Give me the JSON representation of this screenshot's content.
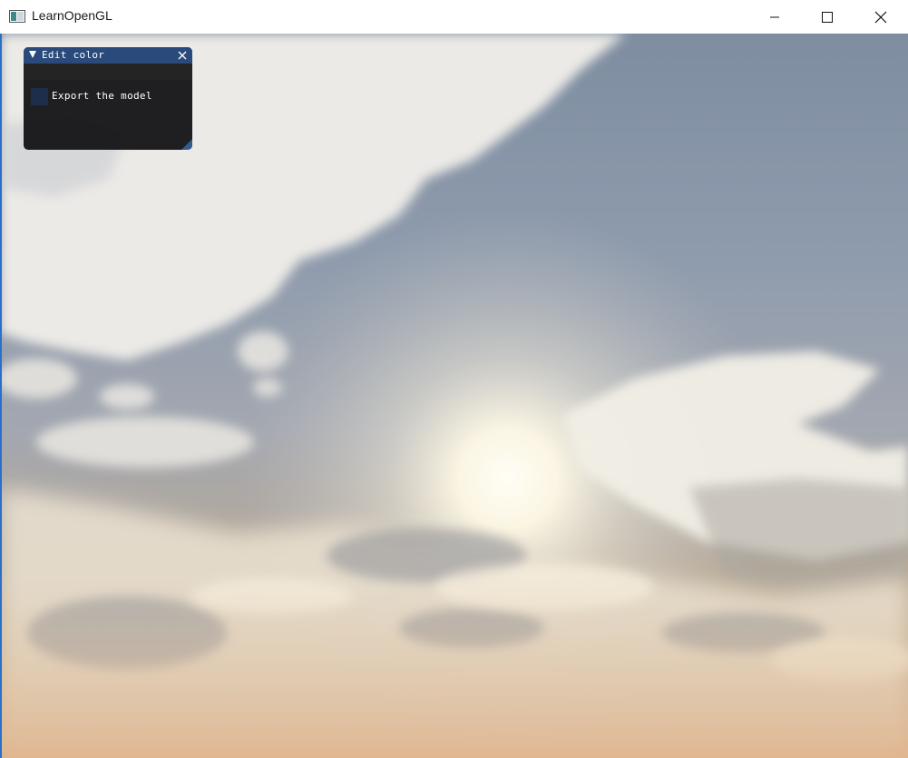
{
  "window": {
    "title": "LearnOpenGL",
    "controls": {
      "minimize_icon": "minimize-icon",
      "maximize_icon": "maximize-icon",
      "close_icon": "close-icon"
    }
  },
  "imgui_panel": {
    "title": "Edit color",
    "checkbox": {
      "label": "Export the model",
      "checked": false
    },
    "colors": {
      "title_bar": "#294a7a",
      "background": "#121214",
      "checkbox": "#1d2e4d"
    }
  },
  "scene": {
    "description_icon": "skybox-viewport"
  }
}
